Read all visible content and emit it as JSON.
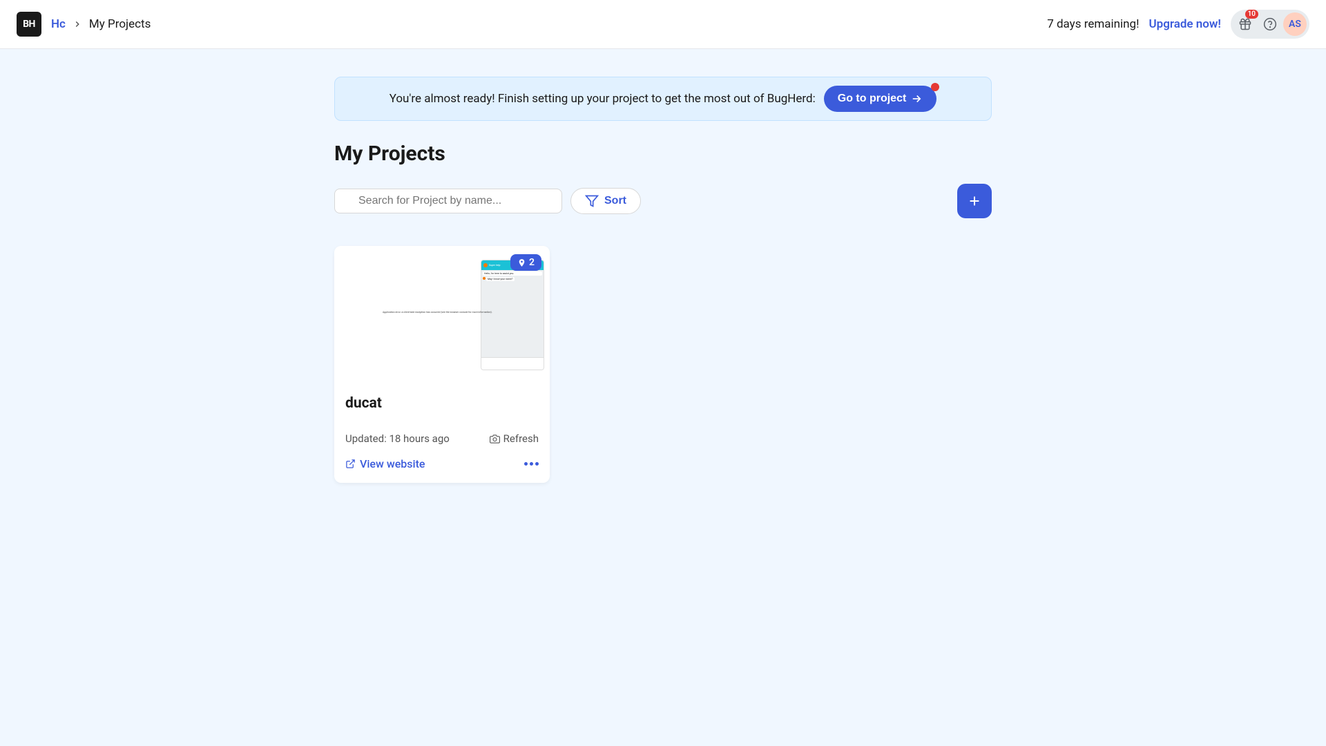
{
  "header": {
    "logo_text": "BH",
    "breadcrumb": {
      "root": "Hc",
      "current": "My Projects"
    },
    "trial_text": "7 days remaining!",
    "upgrade_label": "Upgrade now!",
    "gift_notif_count": "10",
    "avatar_initials": "AS"
  },
  "banner": {
    "text": "You're almost ready! Finish setting up your project to get the most out of BugHerd:",
    "button_label": "Go to project"
  },
  "page": {
    "title": "My Projects",
    "search_placeholder": "Search for Project by name...",
    "sort_label": "Sort"
  },
  "project": {
    "pin_count": "2",
    "name": "ducat",
    "updated_text": "Updated: 18 hours ago",
    "refresh_label": "Refresh",
    "view_label": "View website",
    "preview_chat_title": "Super help",
    "preview_msg1": "Hello, I'm here to assist you",
    "preview_msg2": "May I know your name?",
    "preview_error": "Application error: a client-side exception has occurred (see the browser console for more information)."
  }
}
